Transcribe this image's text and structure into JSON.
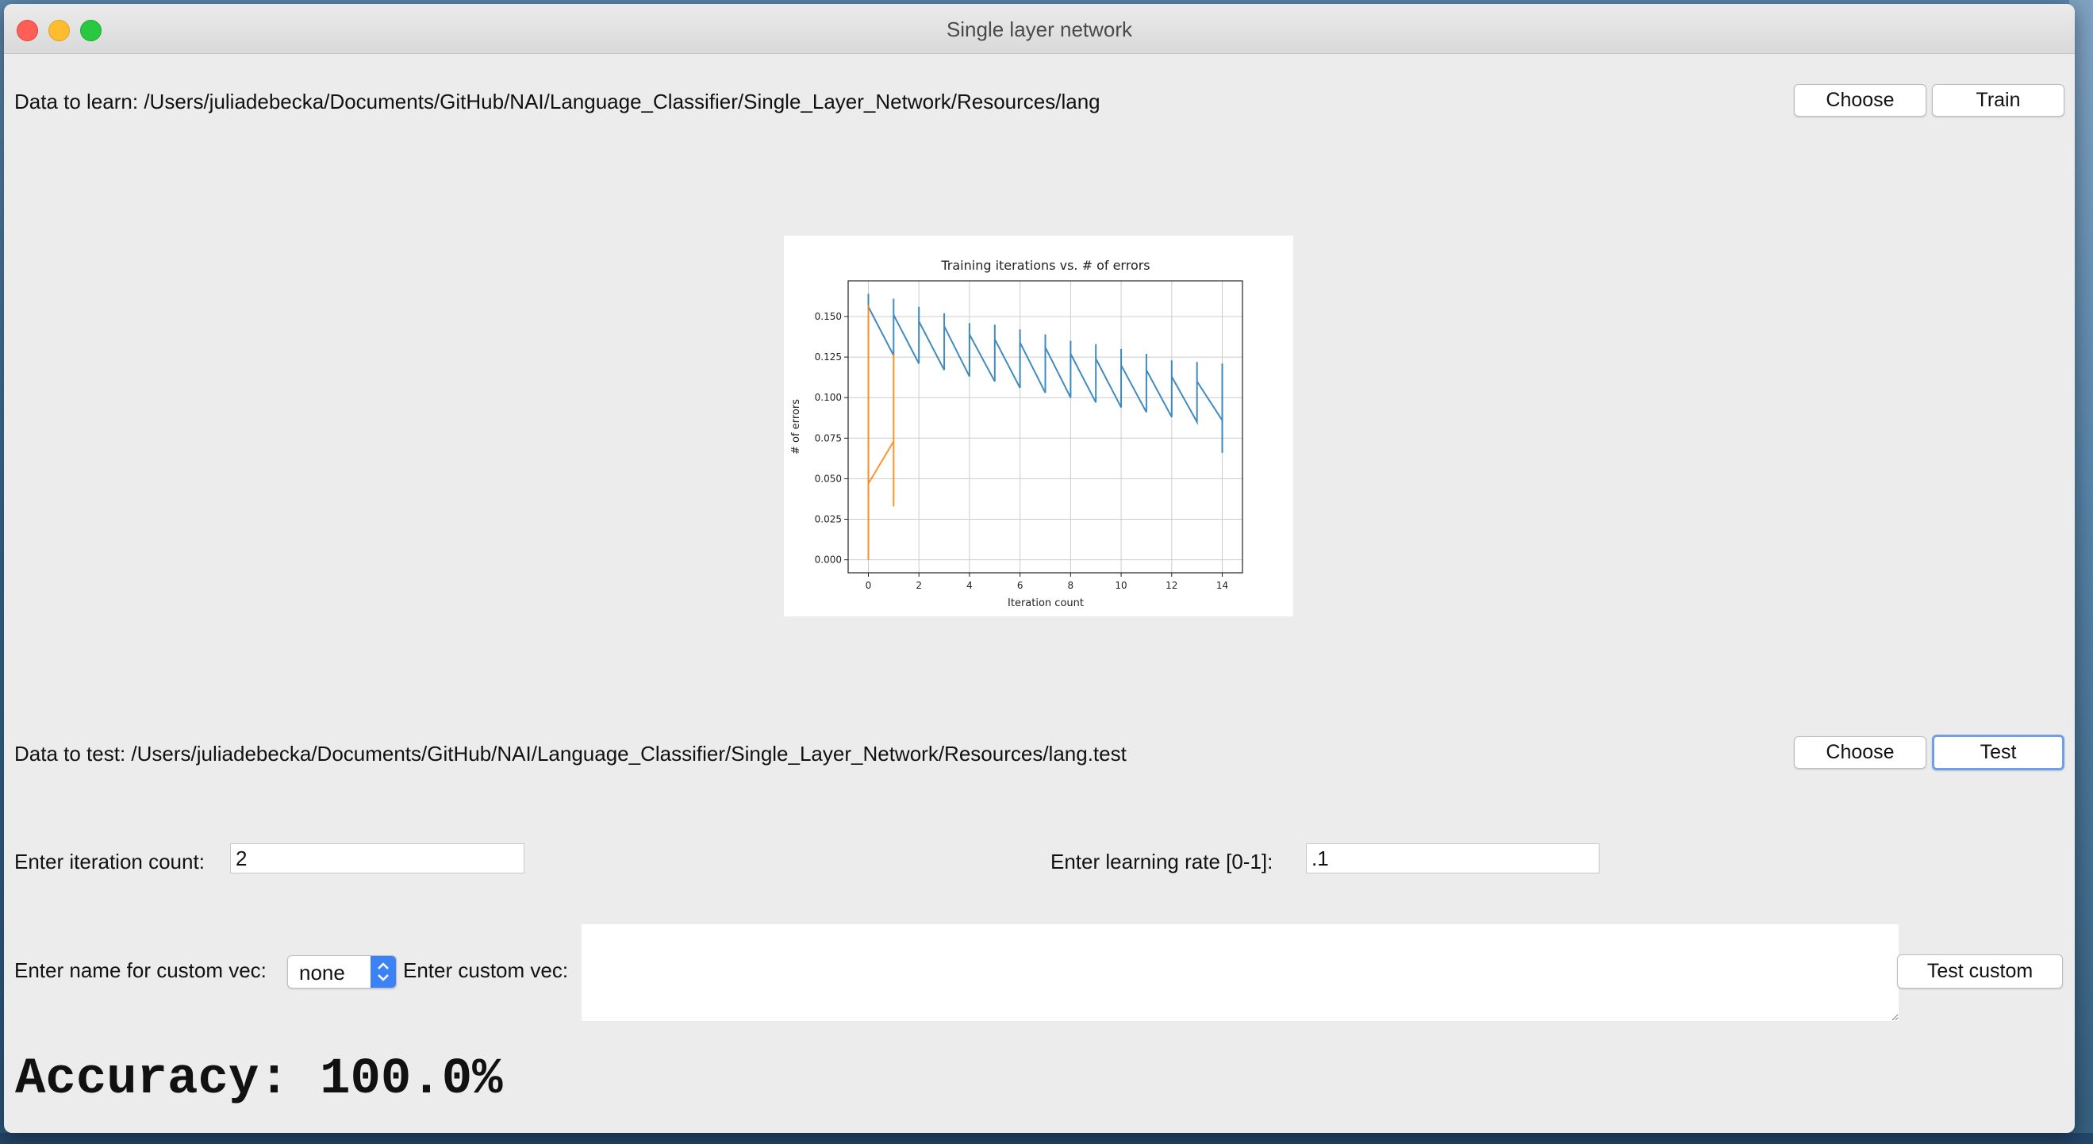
{
  "window": {
    "title": "Single layer network"
  },
  "learn": {
    "label": "Data to learn:",
    "path": "/Users/juliadebecka/Documents/GitHub/NAI/Language_Classifier/Single_Layer_Network/Resources/lang",
    "choose_label": "Choose",
    "train_label": "Train"
  },
  "test": {
    "label": "Data to test:",
    "path": "/Users/juliadebecka/Documents/GitHub/NAI/Language_Classifier/Single_Layer_Network/Resources/lang.test",
    "choose_label": "Choose",
    "test_label": "Test"
  },
  "params": {
    "iteration_label": "Enter iteration count:",
    "iteration_value": "2",
    "rate_label": "Enter learning rate [0-1]:",
    "rate_value": ".1"
  },
  "custom": {
    "name_label": "Enter name for custom vec:",
    "name_value": "none",
    "vec_label": "Enter custom vec:",
    "vec_value": "",
    "button_label": "Test custom"
  },
  "accuracy_text": "Accuracy: 100.0%",
  "colors": {
    "series_blue": "#1f77b4",
    "series_orange": "#ff7f0e",
    "select_accent": "#3b82f7"
  },
  "chart_data": {
    "type": "line",
    "title": "Training iterations vs. # of errors",
    "xlabel": "Iteration count",
    "ylabel": "# of errors",
    "xlim": [
      -0.8,
      14.8
    ],
    "ylim": [
      -0.008,
      0.172
    ],
    "xticks": [
      0,
      2,
      4,
      6,
      8,
      10,
      12,
      14
    ],
    "yticks": [
      "0.000",
      "0.025",
      "0.050",
      "0.075",
      "0.100",
      "0.125",
      "0.150"
    ],
    "grid": true,
    "series": [
      {
        "x": [
          0,
          0,
          0,
          1,
          1,
          1,
          2,
          2,
          2,
          3,
          3,
          3,
          4,
          4,
          4,
          5,
          5,
          5,
          6,
          6,
          6,
          7,
          7,
          7,
          8,
          8,
          8,
          9,
          9,
          9,
          10,
          10,
          10,
          11,
          11,
          11,
          12,
          12,
          12,
          13,
          13,
          13,
          14,
          14,
          14
        ],
        "y": [
          0.164,
          0.156,
          0.156,
          0.126,
          0.161,
          0.151,
          0.121,
          0.156,
          0.147,
          0.117,
          0.152,
          0.144,
          0.113,
          0.146,
          0.139,
          0.11,
          0.145,
          0.136,
          0.106,
          0.142,
          0.134,
          0.103,
          0.139,
          0.131,
          0.1,
          0.135,
          0.127,
          0.097,
          0.133,
          0.124,
          0.094,
          0.13,
          0.12,
          0.091,
          0.127,
          0.117,
          0.088,
          0.123,
          0.113,
          0.085,
          0.122,
          0.11,
          0.086,
          0.121,
          0.066
        ]
      },
      {
        "x": [
          0,
          0,
          0,
          1,
          1,
          1
        ],
        "y": [
          0.0,
          0.157,
          0.047,
          0.073,
          0.127,
          0.033
        ]
      }
    ]
  }
}
